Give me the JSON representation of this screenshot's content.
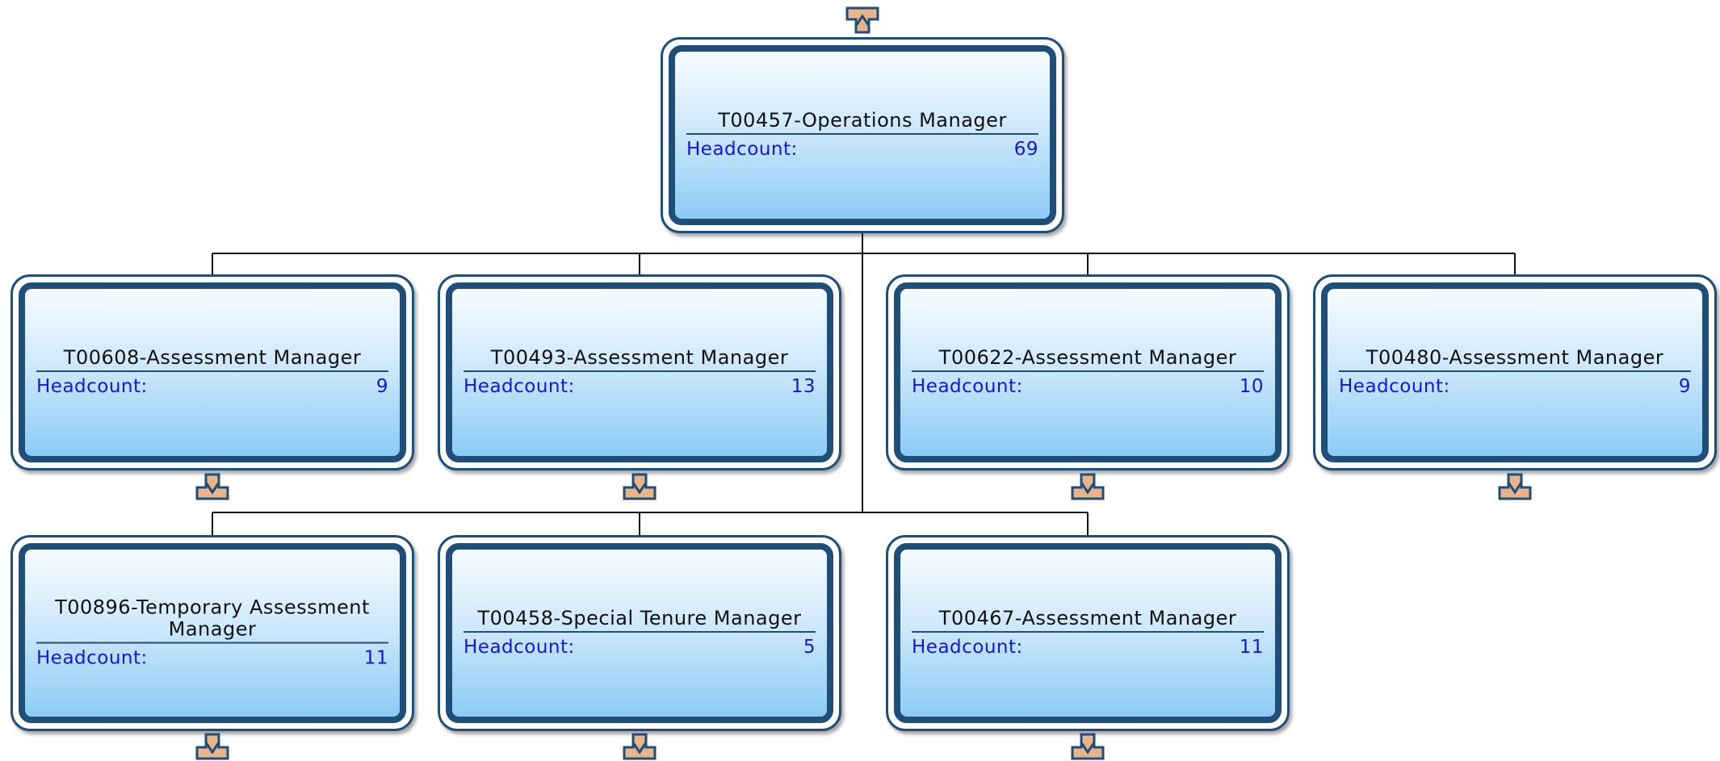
{
  "headcount_label": "Headcount:",
  "colors": {
    "border": "#1f4e79",
    "label": "#1616d8",
    "button_fill": "#e8b48a",
    "button_stroke": "#1f4e79"
  },
  "icons": {
    "collapse": "arrow-up-icon",
    "expand": "arrow-down-icon"
  },
  "root": {
    "title": "T00457-Operations Manager",
    "headcount": "69"
  },
  "children": [
    {
      "title": "T00608-Assessment Manager",
      "headcount": "9"
    },
    {
      "title": "T00493-Assessment Manager",
      "headcount": "13"
    },
    {
      "title": "T00622-Assessment Manager",
      "headcount": "10"
    },
    {
      "title": "T00480-Assessment Manager",
      "headcount": "9"
    },
    {
      "title": "T00896-Temporary Assessment Manager",
      "headcount": "11"
    },
    {
      "title": "T00458-Special Tenure Manager",
      "headcount": "5"
    },
    {
      "title": "T00467-Assessment Manager",
      "headcount": "11"
    }
  ]
}
